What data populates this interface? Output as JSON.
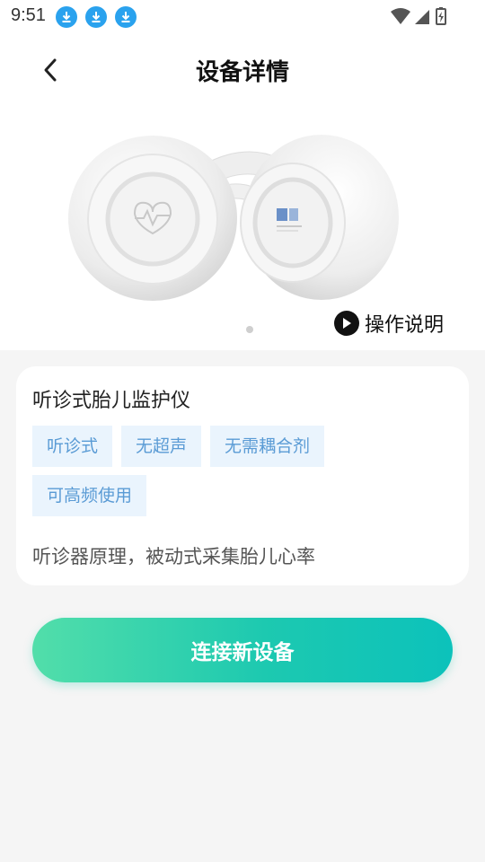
{
  "status_bar": {
    "time": "9:51",
    "notifications": [
      "download-icon",
      "download-icon",
      "download-icon"
    ]
  },
  "header": {
    "title": "设备详情",
    "back_icon": "chevron-left-icon"
  },
  "hero": {
    "operation_guide_label": "操作说明",
    "operation_guide_icon": "play-circle-icon",
    "carousel_page": 1,
    "carousel_total": 1
  },
  "device_card": {
    "name": "听诊式胎儿监护仪",
    "tags": [
      "听诊式",
      "无超声",
      "无需耦合剂",
      "可高频使用"
    ],
    "description": "听诊器原理，被动式采集胎儿心率"
  },
  "actions": {
    "connect_label": "连接新设备"
  },
  "colors": {
    "accent_start": "#52deaa",
    "accent_end": "#0cc2bb",
    "tag_bg": "#eaf4fd",
    "tag_text": "#5a9bd5",
    "download_badge": "#2aa2ee"
  }
}
